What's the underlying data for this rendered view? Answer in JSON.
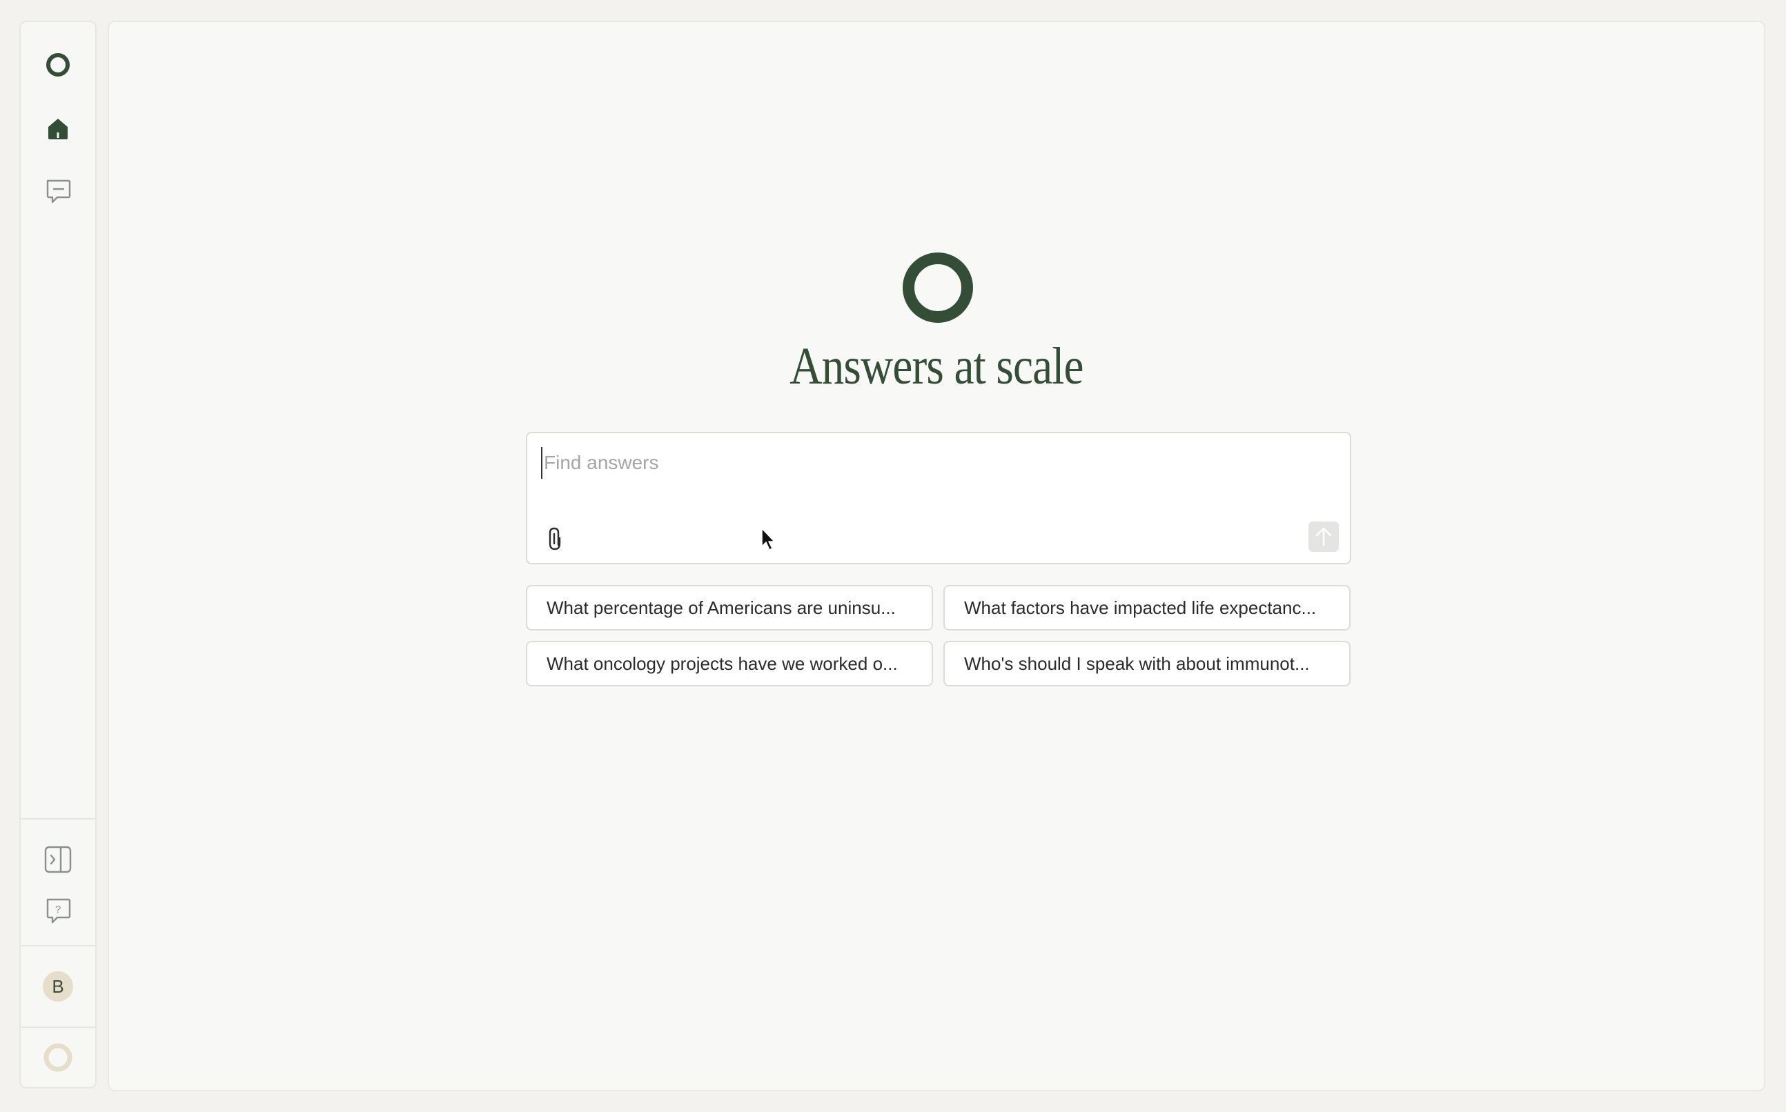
{
  "hero": {
    "title": "Answers at scale"
  },
  "search": {
    "placeholder": "Find answers",
    "value": ""
  },
  "suggestions": [
    "What percentage of Americans are uninsu...",
    "What factors have impacted life expectanc...",
    "What oncology projects have we worked o...",
    "Who's should I speak with about immunot..."
  ],
  "user": {
    "avatar_initial": "B"
  },
  "icons": {
    "sidebar_logo": "logo-ring-icon",
    "home": "home-icon",
    "chats": "chat-icon",
    "expand_sidebar": "expand-sidebar-icon",
    "help": "help-icon",
    "footer_logo": "logo-ring-icon",
    "attach": "paperclip-icon",
    "send": "arrow-up-icon"
  },
  "colors": {
    "brand": "#344d36",
    "background": "#f3f2ef",
    "panel": "#f8f8f7",
    "avatar": "#e6decb",
    "footer_ring": "#e6decb"
  }
}
